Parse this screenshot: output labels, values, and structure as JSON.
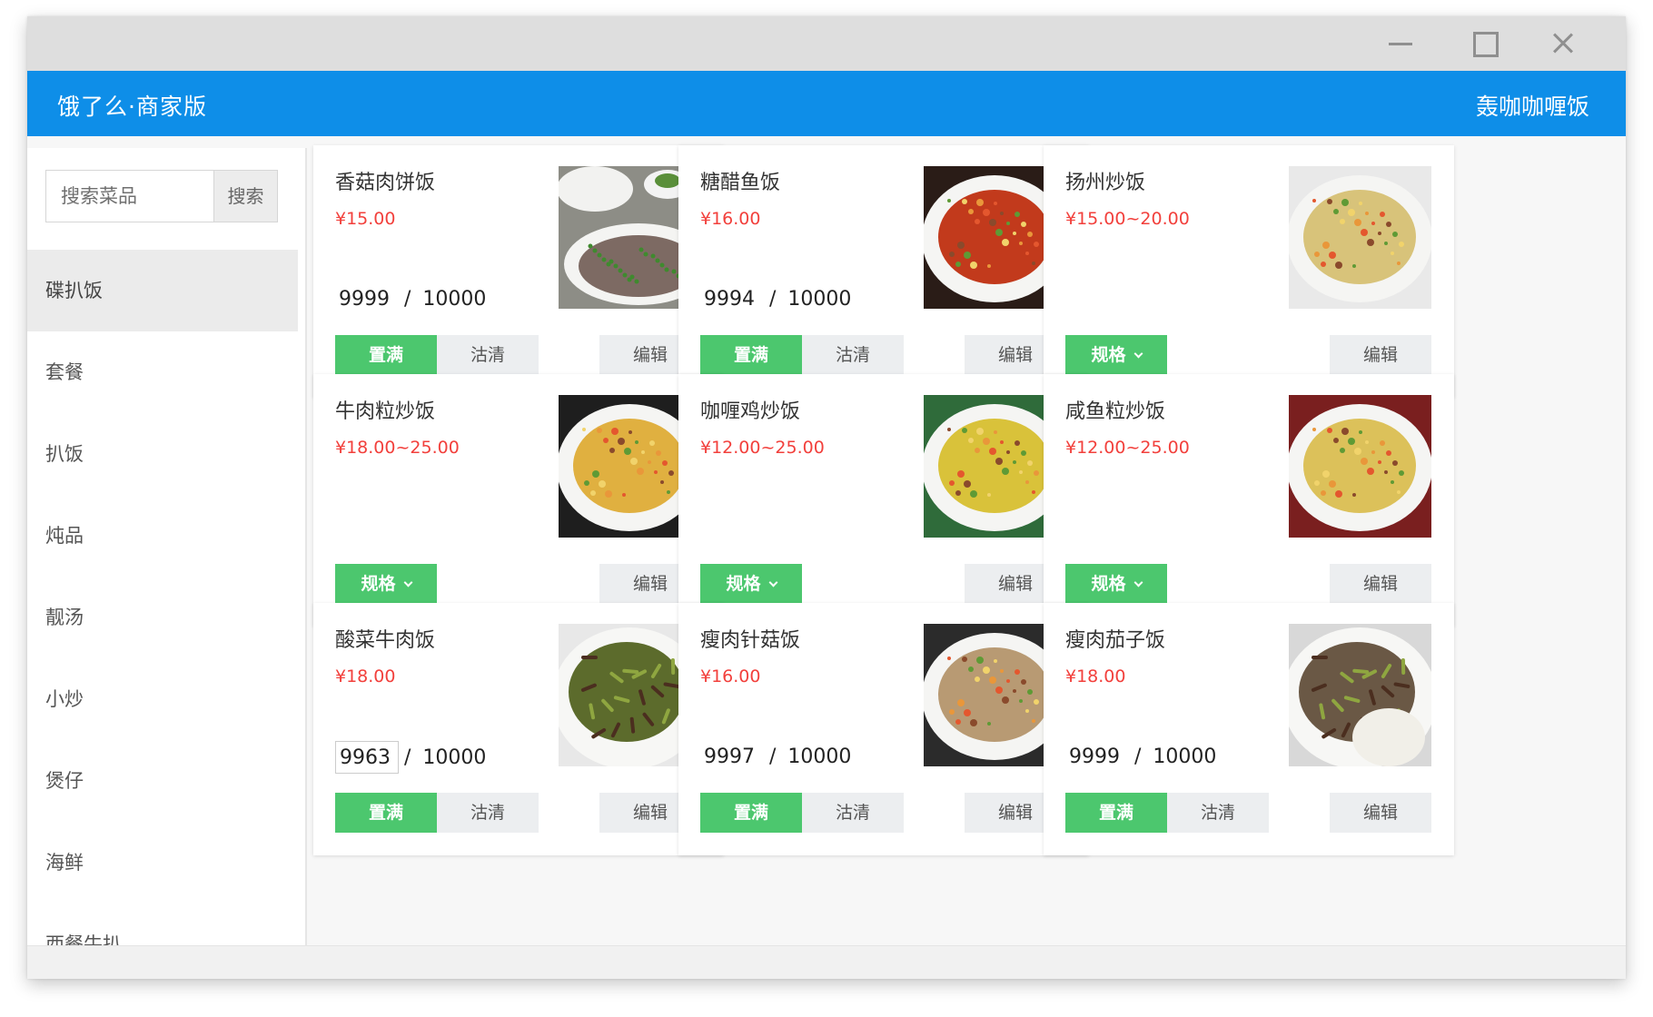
{
  "header": {
    "brand": "饿了么·商家版",
    "shop_name": "轰咖咖喱饭"
  },
  "search": {
    "placeholder": "搜索菜品",
    "button": "搜索"
  },
  "categories": [
    "碟扒饭",
    "套餐",
    "扒饭",
    "炖品",
    "靓汤",
    "小炒",
    "煲仔",
    "海鲜",
    "西餐牛扒"
  ],
  "active_category": "碟扒饭",
  "labels": {
    "full": "置满",
    "clear": "沽清",
    "spec": "规格",
    "edit": "编辑",
    "separator": "/"
  },
  "colors": {
    "header": "#0e8ee8",
    "price": "#f2403c",
    "green": "#4cc76e"
  },
  "dishes": [
    {
      "name": "香菇肉饼饭",
      "price": "¥15.00",
      "stock": "9999",
      "total": "10000",
      "mode": "stock",
      "image_icon": "mushroom-meat-patty-rice-photo"
    },
    {
      "name": "糖醋鱼饭",
      "price": "¥16.00",
      "stock": "9994",
      "total": "10000",
      "mode": "stock",
      "image_icon": "sweet-sour-fish-rice-photo"
    },
    {
      "name": "扬州炒饭",
      "price": "¥15.00~20.00",
      "mode": "spec",
      "image_icon": "yangzhou-fried-rice-photo"
    },
    {
      "name": "牛肉粒炒饭",
      "price": "¥18.00~25.00",
      "mode": "spec",
      "image_icon": "beef-fried-rice-photo"
    },
    {
      "name": "咖喱鸡炒饭",
      "price": "¥12.00~25.00",
      "mode": "spec",
      "image_icon": "curry-chicken-fried-rice-photo"
    },
    {
      "name": "咸鱼粒炒饭",
      "price": "¥12.00~25.00",
      "mode": "spec",
      "image_icon": "salted-fish-fried-rice-photo"
    },
    {
      "name": "酸菜牛肉饭",
      "price": "¥18.00",
      "stock": "9963",
      "total": "10000",
      "mode": "stock",
      "editing": true,
      "image_icon": "pickled-cabbage-beef-rice-photo"
    },
    {
      "name": "瘦肉针菇饭",
      "price": "¥16.00",
      "stock": "9997",
      "total": "10000",
      "mode": "stock",
      "image_icon": "pork-enoki-rice-photo"
    },
    {
      "name": "瘦肉茄子饭",
      "price": "¥18.00",
      "stock": "9999",
      "total": "10000",
      "mode": "stock",
      "image_icon": "pork-eggplant-rice-photo"
    }
  ]
}
